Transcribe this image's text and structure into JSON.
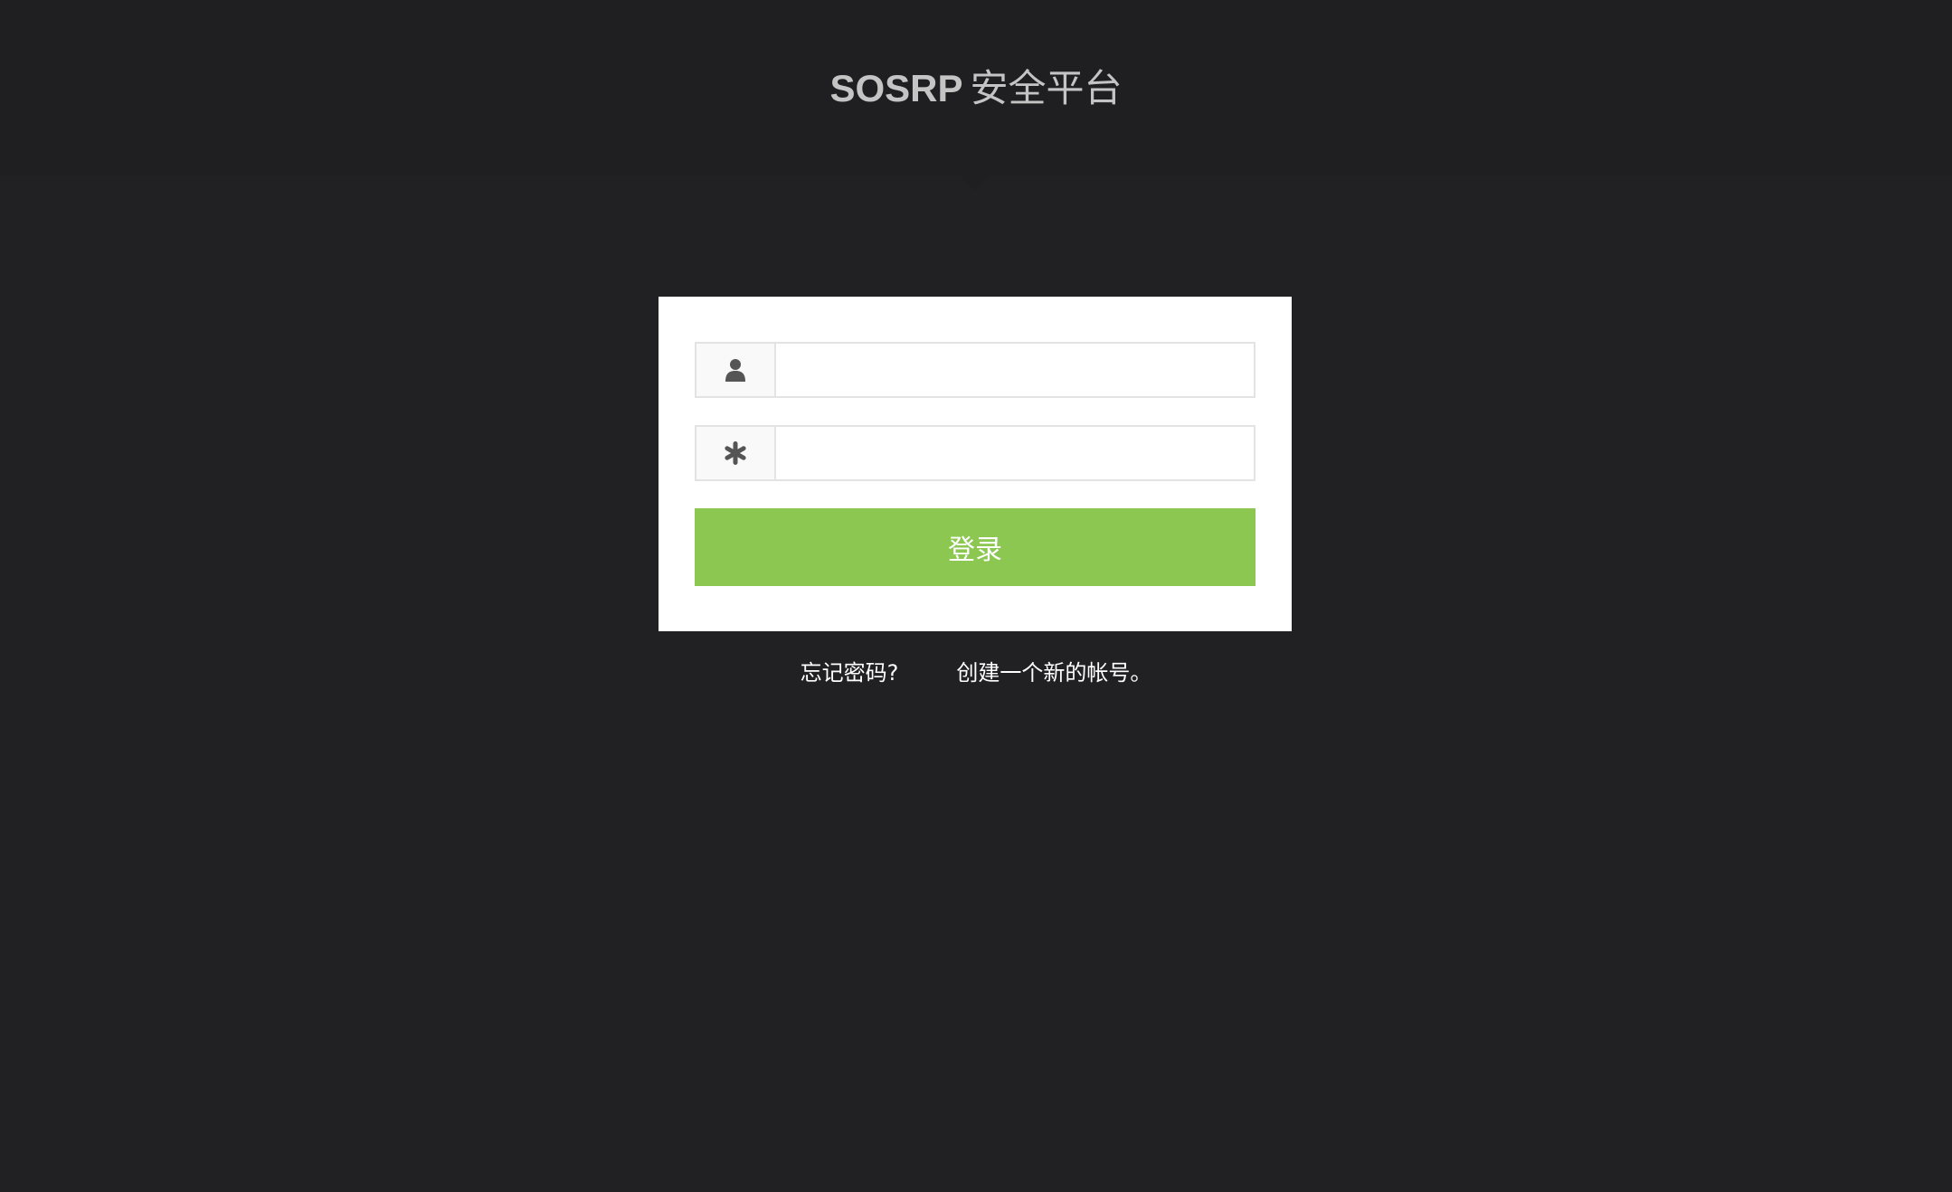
{
  "brand": {
    "name": "SOSRP",
    "subtitle": "安全平台",
    "color": "#c4c4c4"
  },
  "login_form": {
    "username": {
      "icon": "user-icon",
      "value": "",
      "placeholder": ""
    },
    "password": {
      "icon": "asterisk-icon",
      "value": "",
      "placeholder": ""
    },
    "submit_label": "登录",
    "accent_color": "#8cc752"
  },
  "links": {
    "forgot_password": "忘记密码?",
    "create_account": "创建一个新的帐号。"
  },
  "colors": {
    "page_background": "#212123",
    "header_background": "#1f1f21",
    "card_background": "#ffffff",
    "icon_color": "#555555"
  }
}
